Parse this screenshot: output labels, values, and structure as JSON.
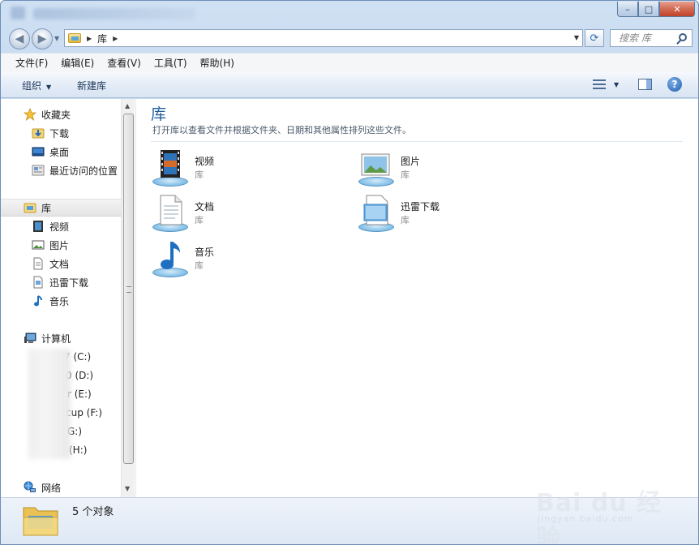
{
  "window": {
    "title_blurred": true,
    "controls": {
      "minimize": "–",
      "maximize": "□",
      "close": "✕"
    }
  },
  "navbar": {
    "back_glyph": "◀",
    "forward_glyph": "▶",
    "address": {
      "crumb": "库"
    },
    "search": {
      "placeholder": "搜索 库"
    }
  },
  "menubar": {
    "items": [
      "文件(F)",
      "编辑(E)",
      "查看(V)",
      "工具(T)",
      "帮助(H)"
    ]
  },
  "toolbar": {
    "organize_label": "组织",
    "new_library_label": "新建库"
  },
  "sidebar": {
    "favorites": {
      "header": "收藏夹",
      "items": [
        "下载",
        "桌面",
        "最近访问的位置"
      ]
    },
    "libraries": {
      "header": "库",
      "items": [
        "视频",
        "图片",
        "文档",
        "迅雷下载",
        "音乐"
      ]
    },
    "computer": {
      "header": "计算机",
      "drives": [
        "7 (C:)",
        "0 (D:)",
        "r (E:)",
        "cup (F:)",
        "G:)",
        "(H:)"
      ]
    },
    "network": {
      "header": "网络"
    }
  },
  "main": {
    "title": "库",
    "description": "打开库以查看文件并根据文件夹、日期和其他属性排列这些文件。",
    "libraries": [
      {
        "name": "视频",
        "type": "库",
        "icon": "video-library-icon"
      },
      {
        "name": "图片",
        "type": "库",
        "icon": "pictures-library-icon"
      },
      {
        "name": "文档",
        "type": "库",
        "icon": "documents-library-icon"
      },
      {
        "name": "迅雷下载",
        "type": "库",
        "icon": "thunder-download-library-icon"
      },
      {
        "name": "音乐",
        "type": "库",
        "icon": "music-library-icon"
      }
    ]
  },
  "statusbar": {
    "count_text": "5 个对象"
  },
  "watermark": {
    "main": "Bai du 经验",
    "sub": "jingyan.baidu.com"
  },
  "colors": {
    "title_accent": "#1e5d9e",
    "frame": "#bcd3ec",
    "selection": "#e4e4e4",
    "platter": "#7fbde6"
  }
}
